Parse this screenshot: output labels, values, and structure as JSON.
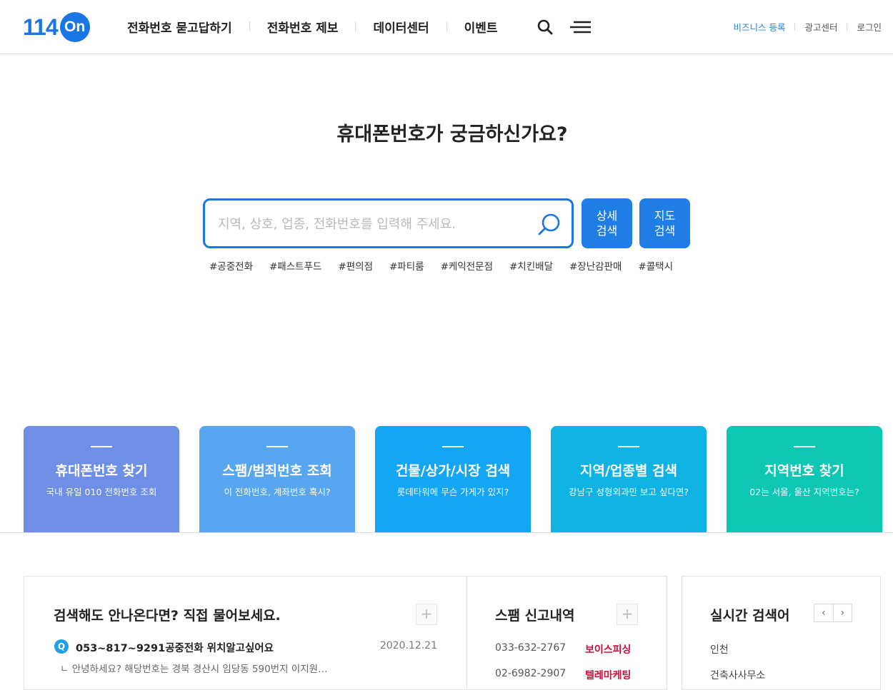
{
  "header": {
    "logo_number": "114",
    "logo_on": "On",
    "nav": [
      "전화번호 묻고답하기",
      "전화번호 제보",
      "데이터센터",
      "이벤트"
    ],
    "search_icon": "search-icon",
    "menu_icon": "hamburger-menu-icon",
    "util": [
      "비즈니스 등록",
      "광고센터",
      "로그인"
    ]
  },
  "hero": {
    "title": "휴대폰번호가 궁금하신가요?",
    "search_placeholder": "지역, 상호, 업종, 전화번호를 입력해 주세요.",
    "btn_detail": "상세\n검색",
    "btn_map": "지도\n검색",
    "tags": [
      "#공중전화",
      "#패스트푸드",
      "#편의점",
      "#파티룸",
      "#케익전문점",
      "#치킨배달",
      "#장난감판매",
      "#콜택시"
    ]
  },
  "cards": [
    {
      "title": "휴대폰번호 찾기",
      "sub": "국내 유일 010 전화번호 조회",
      "color": "#6f8fe6"
    },
    {
      "title": "스팸/범죄번호 조회",
      "sub": "이 전화번호, 계좌번호 혹시?",
      "color": "#59a6f0"
    },
    {
      "title": "건물/상가/시장 검색",
      "sub": "롯데타워에 무슨 가게가 있지?",
      "color": "#14a6f3"
    },
    {
      "title": "지역/업종별 검색",
      "sub": "강남구 성형외과만 보고 싶다면?",
      "color": "#0eb2e3"
    },
    {
      "title": "지역번호 찾기",
      "sub": "02는 서울, 울산 지역번호는?",
      "color": "#0ec6b4"
    }
  ],
  "qa": {
    "title": "검색해도 안나온다면? 직접 물어보세요.",
    "plus": "+",
    "badge": "Q",
    "question": "053~817~9291공중전화 위치알고싶어요",
    "date": "2020.12.21",
    "answer": "ㄴ 안녕하세요? 해당번호는 경북 경산시 임당동 590번지 이지원…"
  },
  "spam": {
    "title": "스팸 신고내역",
    "plus": "+",
    "rows": [
      {
        "number": "033-632-2767",
        "type": "보이스피싱"
      },
      {
        "number": "02-6982-2907",
        "type": "텔레마케팅"
      }
    ]
  },
  "realtime": {
    "title": "실시간 검색어",
    "prev": "‹",
    "next": "›",
    "items": [
      "인천",
      "건축사사무소"
    ]
  }
}
